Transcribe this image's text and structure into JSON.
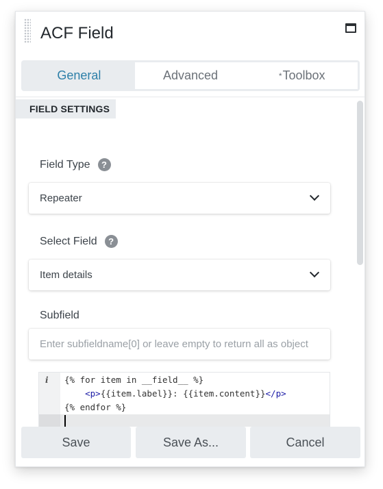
{
  "panel": {
    "title": "ACF Field"
  },
  "tabs": [
    {
      "label": "General",
      "active": true
    },
    {
      "label": "Advanced",
      "active": false
    },
    {
      "label": "Toolbox",
      "prefix": "*",
      "active": false
    }
  ],
  "section": {
    "title": "FIELD SETTINGS"
  },
  "fields": {
    "field_type": {
      "label": "Field Type",
      "value": "Repeater",
      "help_icon": "?"
    },
    "select_field": {
      "label": "Select Field",
      "value": "Item details",
      "help_icon": "?"
    },
    "subfield": {
      "label": "Subfield",
      "placeholder": "Enter subfieldname[0] or leave empty to return all as object",
      "value": ""
    }
  },
  "code": {
    "gutter_icon": "i",
    "line1": "{% for item in __field__ %}",
    "line2_indent": "    ",
    "line2_open": "<p>",
    "line2_text": "{{item.label}}: {{item.content}}",
    "line2_close": "</p>",
    "line3": "{% endfor %}"
  },
  "footer": {
    "save": "Save",
    "save_as": "Save As...",
    "cancel": "Cancel"
  },
  "icons": {
    "maximize": "maximize-icon",
    "drag": "drag-handle-icon",
    "help": "help-icon",
    "chevron": "chevron-down-icon",
    "info": "info-icon"
  },
  "colors": {
    "accent": "#2d7fa8",
    "tab_bg": "#e9ecef",
    "button_bg": "#e9ecef"
  }
}
